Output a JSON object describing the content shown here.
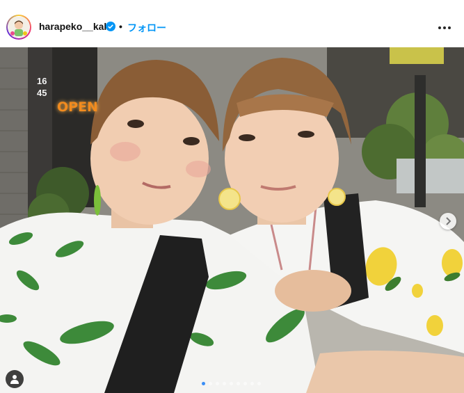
{
  "post_header": {
    "username": "harapeko__kako",
    "separator": "•",
    "follow_label": "フォロー"
  },
  "photo": {
    "storefront_number": "1645",
    "open_sign": "OPEN"
  },
  "carousel": {
    "total_slides": 9,
    "current_slide": 1
  },
  "colors": {
    "verified": "#0095f6",
    "follow": "#0095f6",
    "active_dot": "#3a8ef6",
    "open_sign": "#f28b1e"
  },
  "icons": [
    "verified-badge-icon",
    "more-options-icon",
    "chevron-right-icon",
    "tagged-user-icon"
  ]
}
